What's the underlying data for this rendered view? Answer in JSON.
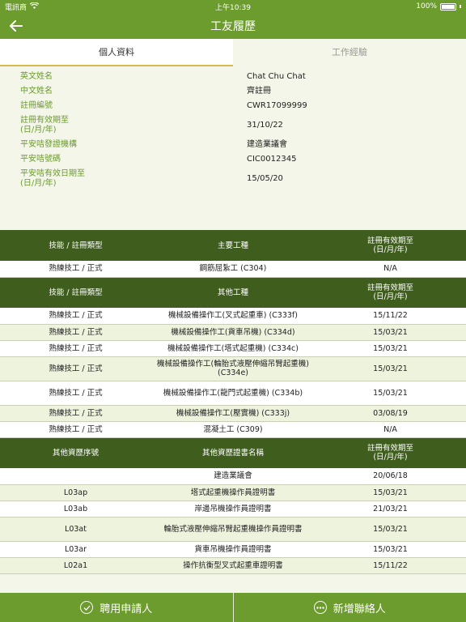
{
  "status": {
    "carrier": "電訊商",
    "time": "上午10:39",
    "battery": "100%"
  },
  "nav": {
    "title": "工友履歷"
  },
  "tabs": [
    {
      "label": "個人資料"
    },
    {
      "label": "工作經驗"
    }
  ],
  "info": [
    {
      "label": "英文姓名",
      "value": "Chat Chu Chat"
    },
    {
      "label": "中文姓名",
      "value": "齊註冊"
    },
    {
      "label": "註冊編號",
      "value": "CWR17099999"
    },
    {
      "label": "註冊有效期至\n(日/月/年)",
      "value": "31/10/22"
    },
    {
      "label": "平安咭發證機構",
      "value": "建造業議會"
    },
    {
      "label": "平安咭號碼",
      "value": "CIC0012345"
    },
    {
      "label": "平安咭有效日期至\n(日/月/年)",
      "value": "15/05/20"
    }
  ],
  "main_trade": {
    "headers": [
      "技能 / 註冊類型",
      "主要工種",
      "註冊有效期至\n(日/月/年)"
    ],
    "rows": [
      [
        "熟練技工 / 正式",
        "鋼筋屈紮工 (C304)",
        "N/A"
      ]
    ]
  },
  "other_trades": {
    "headers": [
      "技能 / 註冊類型",
      "其他工種",
      "註冊有效期至\n(日/月/年)"
    ],
    "rows": [
      [
        "熟練技工 / 正式",
        "機械設備操作工(叉式起重車) (C333f)",
        "15/11/22"
      ],
      [
        "熟練技工 / 正式",
        "機械設備操作工(貨車吊機) (C334d)",
        "15/03/21"
      ],
      [
        "熟練技工 / 正式",
        "機械設備操作工(塔式起重機) (C334c)",
        "15/03/21"
      ],
      [
        "熟練技工 / 正式",
        "機械設備操作工(輪胎式液壓伸縮吊臂起重機) (C334e)",
        "15/03/21"
      ],
      [
        "熟練技工 / 正式",
        "機械設備操作工(龍門式起重機) (C334b)",
        "15/03/21"
      ],
      [
        "熟練技工 / 正式",
        "機械設備操作工(壓實機) (C333j)",
        "03/08/19"
      ],
      [
        "熟練技工 / 正式",
        "混凝土工 (C309)",
        "N/A"
      ]
    ]
  },
  "qualifications": {
    "headers": [
      "其他資歷序號",
      "其他資歷證書名稱",
      "註冊有效期至\n(日/月/年)"
    ],
    "rows": [
      [
        "",
        "建造業議會",
        "20/06/18"
      ],
      [
        "L03ap",
        "塔式起重機操作員證明書",
        "15/03/21"
      ],
      [
        "L03ab",
        "岸邊吊機操作員證明書",
        "21/03/21"
      ],
      [
        "L03at",
        "輪胎式液壓伸縮吊臂起重機操作員證明書",
        "15/03/21"
      ],
      [
        "L03ar",
        "貨車吊機操作員證明書",
        "15/03/21"
      ],
      [
        "L02a1",
        "操作抗衡型叉式起重車證明書",
        "15/11/22"
      ]
    ]
  },
  "bottom": {
    "hire_label": "聘用申請人",
    "add_contact_label": "新增聯絡人"
  }
}
